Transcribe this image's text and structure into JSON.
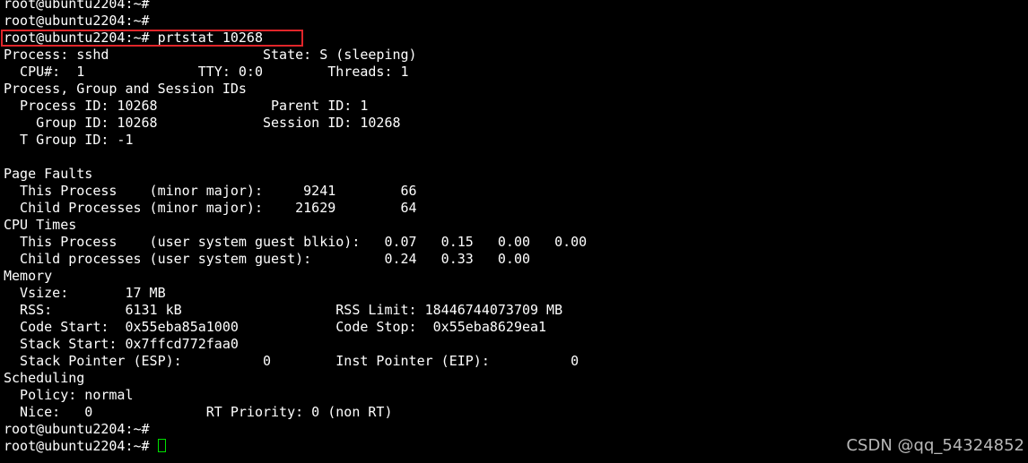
{
  "terminal": {
    "lines": [
      "root@ubuntu2204:~#",
      "root@ubuntu2204:~#",
      "root@ubuntu2204:~# prtstat 10268",
      "Process: sshd                   State: S (sleeping)",
      "  CPU#:  1              TTY: 0:0        Threads: 1",
      "Process, Group and Session IDs",
      "  Process ID: 10268              Parent ID: 1",
      "    Group ID: 10268             Session ID: 10268",
      "  T Group ID: -1",
      "",
      "Page Faults",
      "  This Process    (minor major):     9241        66",
      "  Child Processes (minor major):    21629        64",
      "CPU Times",
      "  This Process    (user system guest blkio):   0.07   0.15   0.00   0.00",
      "  Child processes (user system guest):         0.24   0.33   0.00",
      "Memory",
      "  Vsize:       17 MB",
      "  RSS:         6131 kB                   RSS Limit: 18446744073709 MB",
      "  Code Start:  0x55eba85a1000            Code Stop:  0x55eba8629ea1",
      "  Stack Start: 0x7ffcd772faa0",
      "  Stack Pointer (ESP):          0        Inst Pointer (EIP):          0",
      "Scheduling",
      "  Policy: normal",
      "  Nice:   0              RT Priority: 0 (non RT)",
      "root@ubuntu2204:~#"
    ],
    "prompt": "root@ubuntu2204:~# ",
    "cursor_color": "#00e000",
    "highlight_color": "#e0252a",
    "background_color": "#000000",
    "text_color": "#ffffff"
  },
  "watermark": {
    "text": "CSDN @qq_54324852"
  }
}
